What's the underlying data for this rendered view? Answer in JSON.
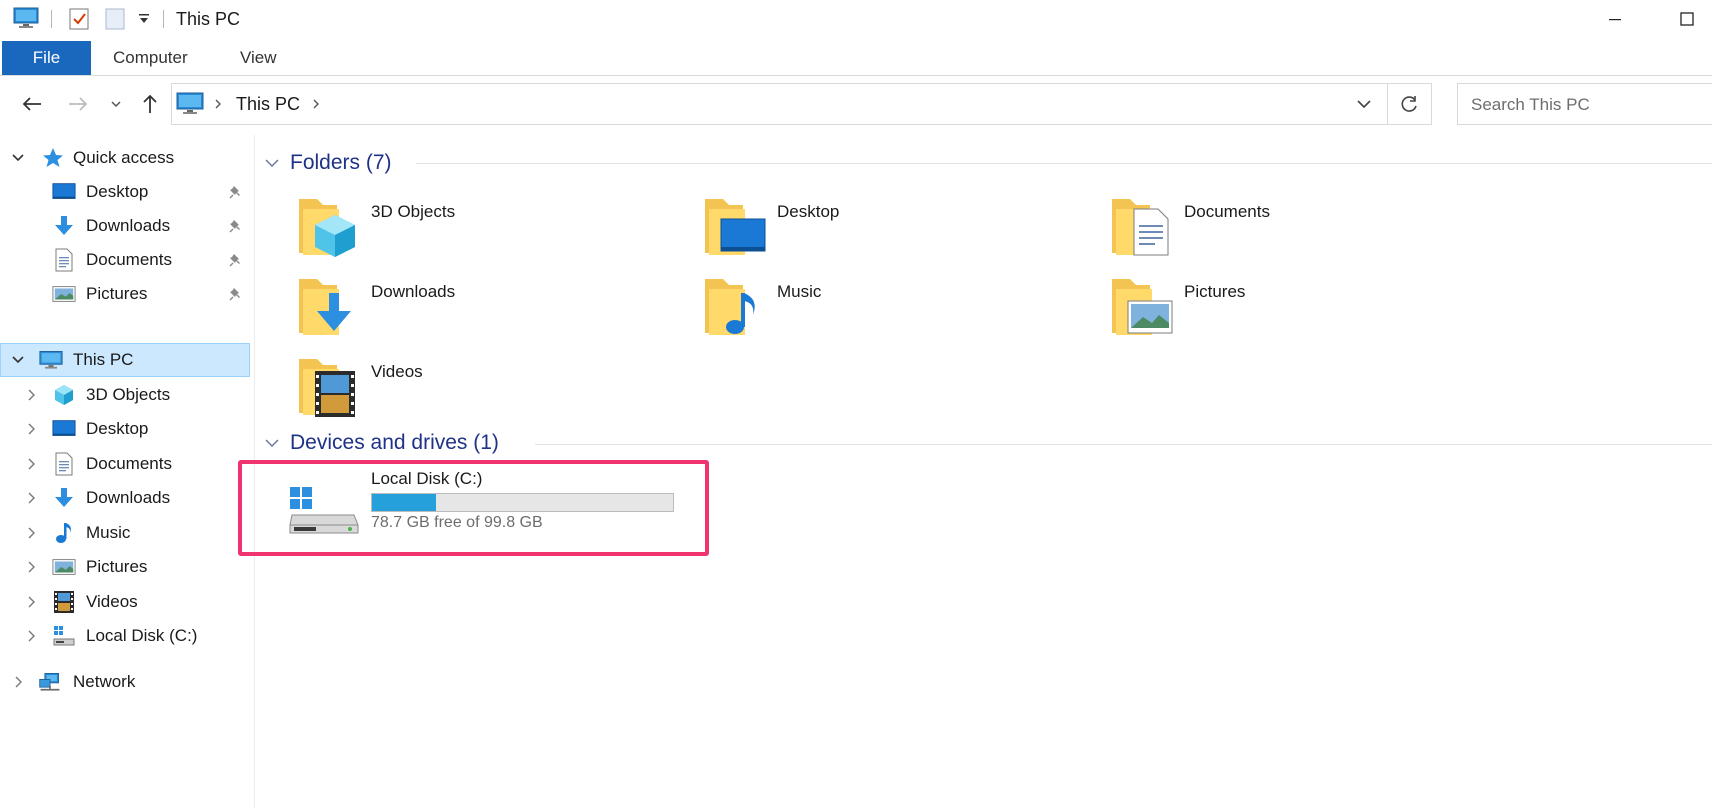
{
  "window": {
    "title": "This PC"
  },
  "ribbon": {
    "tabs": [
      {
        "label": "File"
      },
      {
        "label": "Computer"
      },
      {
        "label": "View"
      }
    ]
  },
  "navigation": {
    "address_path": "This PC",
    "search_placeholder": "Search This PC"
  },
  "sidebar": {
    "quick_access": {
      "label": "Quick access",
      "items": [
        {
          "label": "Desktop",
          "icon": "desktop-icon",
          "pinned": true
        },
        {
          "label": "Downloads",
          "icon": "downloads-icon",
          "pinned": true
        },
        {
          "label": "Documents",
          "icon": "documents-icon",
          "pinned": true
        },
        {
          "label": "Pictures",
          "icon": "pictures-icon",
          "pinned": true
        }
      ]
    },
    "this_pc": {
      "label": "This PC",
      "selected": true,
      "items": [
        {
          "label": "3D Objects",
          "icon": "3d-objects-icon"
        },
        {
          "label": "Desktop",
          "icon": "desktop-icon"
        },
        {
          "label": "Documents",
          "icon": "documents-icon"
        },
        {
          "label": "Downloads",
          "icon": "downloads-icon"
        },
        {
          "label": "Music",
          "icon": "music-icon"
        },
        {
          "label": "Pictures",
          "icon": "pictures-icon"
        },
        {
          "label": "Videos",
          "icon": "videos-icon"
        },
        {
          "label": "Local Disk (C:)",
          "icon": "local-disk-icon"
        }
      ]
    },
    "network": {
      "label": "Network"
    }
  },
  "content": {
    "folders_group": {
      "title": "Folders (7)",
      "items": [
        {
          "label": "3D Objects",
          "icon": "3d-objects-folder-icon"
        },
        {
          "label": "Desktop",
          "icon": "desktop-folder-icon"
        },
        {
          "label": "Documents",
          "icon": "documents-folder-icon"
        },
        {
          "label": "Downloads",
          "icon": "downloads-folder-icon"
        },
        {
          "label": "Music",
          "icon": "music-folder-icon"
        },
        {
          "label": "Pictures",
          "icon": "pictures-folder-icon"
        },
        {
          "label": "Videos",
          "icon": "videos-folder-icon"
        }
      ]
    },
    "drives_group": {
      "title": "Devices and drives (1)",
      "items": [
        {
          "label": "Local Disk (C:)",
          "free_text": "78.7 GB free of 99.8 GB",
          "used_fraction": 0.211,
          "icon": "hard-drive-icon"
        }
      ]
    }
  },
  "colors": {
    "accent": "#1a68bd",
    "selection": "#cce8ff",
    "group_title": "#1e3287",
    "usage_bar": "#26a0da",
    "highlight": "#f0356e"
  }
}
